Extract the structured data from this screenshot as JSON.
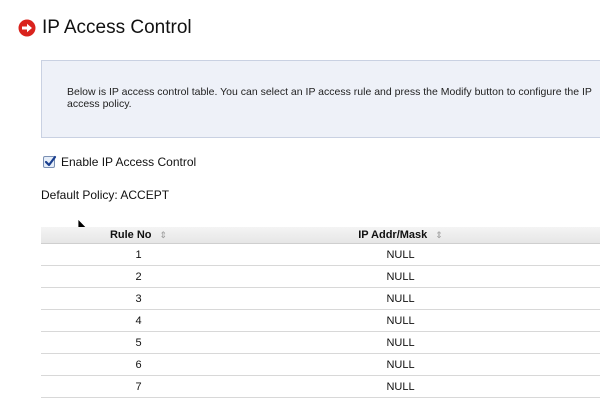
{
  "page": {
    "title": "IP Access Control",
    "title_icon": "red-circle-arrow-icon"
  },
  "info": {
    "text": "Below is IP access control table. You can select an IP access rule and press the Modify button to configure the IP access policy."
  },
  "enable": {
    "label": "Enable IP Access Control",
    "checked": true
  },
  "default_policy": {
    "text": "Default Policy: ACCEPT"
  },
  "table": {
    "headers": [
      "Rule No",
      "IP Addr/Mask"
    ],
    "sort_glyph": "⇕",
    "rows": [
      [
        "1",
        "NULL"
      ],
      [
        "2",
        "NULL"
      ],
      [
        "3",
        "NULL"
      ],
      [
        "4",
        "NULL"
      ],
      [
        "5",
        "NULL"
      ],
      [
        "6",
        "NULL"
      ],
      [
        "7",
        "NULL"
      ]
    ]
  },
  "colors": {
    "accent_red": "#d9231d",
    "info_bg": "#eef1f8"
  }
}
